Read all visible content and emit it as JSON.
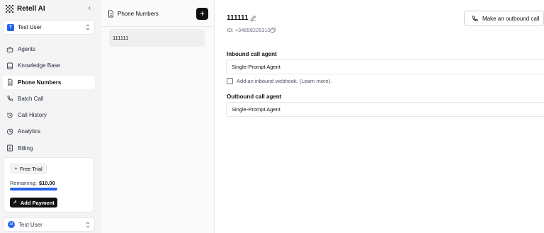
{
  "app": {
    "name": "Retell AI"
  },
  "workspace_select": {
    "user": "Test User",
    "avatar_letter": "T"
  },
  "nav": {
    "items": [
      {
        "label": "Agents",
        "icon": "bot-icon",
        "active": false
      },
      {
        "label": "Knowledge Base",
        "icon": "book-icon",
        "active": false
      },
      {
        "label": "Phone Numbers",
        "icon": "sim-icon",
        "active": true
      },
      {
        "label": "Batch Call",
        "icon": "phone-icon",
        "active": false
      },
      {
        "label": "Call History",
        "icon": "history-icon",
        "active": false
      },
      {
        "label": "Analytics",
        "icon": "pie-chart-icon",
        "active": false
      },
      {
        "label": "Billing",
        "icon": "receipt-icon",
        "active": false
      }
    ]
  },
  "trial": {
    "badge": "Free Trial",
    "remaining_label": "Remaining:",
    "remaining_value": "$10.00",
    "progress_fraction": 1.0,
    "button": "Add Payment"
  },
  "bottom_user": {
    "name": "Test User",
    "initials": "JA"
  },
  "phone_panel": {
    "title": "Phone Numbers",
    "add_label": "+",
    "items": [
      {
        "label": "111111"
      }
    ]
  },
  "detail": {
    "number": "111111",
    "id_text": "ID: +34858229319",
    "outbound_button": "Make an outbound call",
    "inbound_label": "Inbound call agent",
    "inbound_value": "Single-Prompt Agent",
    "webhook_text": "Add an inbound webhook. (Learn more).",
    "outbound_label": "Outbound call agent",
    "outbound_value": "Single-Prompt Agent"
  },
  "colors": {
    "accent": "#2563eb",
    "dark": "#111111",
    "sidebar_bg": "#f4f4f5"
  }
}
